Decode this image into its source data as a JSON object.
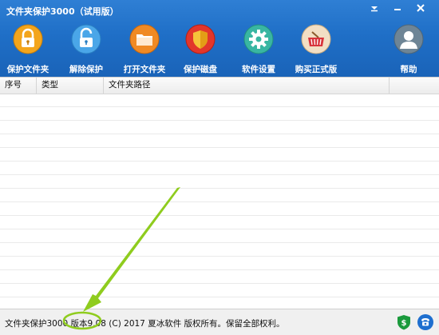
{
  "window": {
    "title": "文件夹保护3000（试用版）"
  },
  "toolbar": {
    "buttons": [
      {
        "label": "保护文件夹",
        "icon": "lock-icon"
      },
      {
        "label": "解除保护",
        "icon": "unlock-icon"
      },
      {
        "label": "打开文件夹",
        "icon": "folder-icon"
      },
      {
        "label": "保护磁盘",
        "icon": "shield-icon"
      },
      {
        "label": "软件设置",
        "icon": "gear-icon"
      },
      {
        "label": "购买正式版",
        "icon": "shopping-basket-icon"
      },
      {
        "label": "帮助",
        "icon": "user-help-icon"
      }
    ]
  },
  "table": {
    "columns": [
      "序号",
      "类型",
      "文件夹路径"
    ]
  },
  "status": {
    "text": "文件夹保护3000 版本9.08 (C) 2017 夏冰软件 版权所有。保留全部权利。"
  },
  "colors": {
    "title_bar": "#1f6fc7",
    "annotation": "#8fcc1e",
    "shield_green": "#1a9a3c",
    "phone_blue": "#1e6fcf"
  }
}
